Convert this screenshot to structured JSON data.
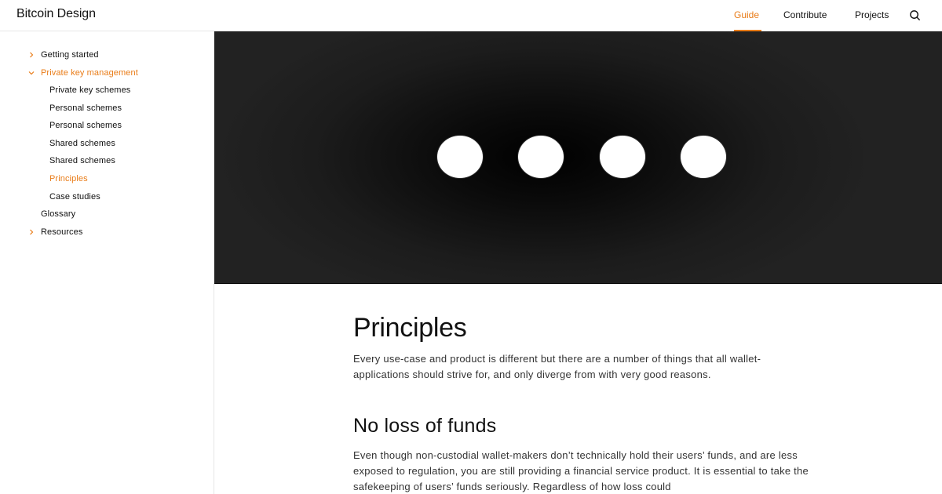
{
  "header": {
    "logo": "Bitcoin Design",
    "nav": [
      {
        "label": "Guide",
        "active": true
      },
      {
        "label": "Contribute",
        "active": false
      },
      {
        "label": "Projects",
        "active": false
      }
    ],
    "search_icon": "search-icon"
  },
  "colors": {
    "accent": "#e97c18",
    "text": "#111111",
    "hero_bg": "#111111"
  },
  "sidebar": {
    "items": [
      {
        "label": "Getting started",
        "icon": "chevron-right-icon"
      },
      {
        "label": "Private key management",
        "icon": "chevron-down-icon"
      },
      {
        "label": "Private key schemes"
      },
      {
        "label": "Personal schemes"
      },
      {
        "label": "Personal schemes"
      },
      {
        "label": "Shared schemes"
      },
      {
        "label": "Shared schemes"
      },
      {
        "label": "Principles"
      },
      {
        "label": "Case studies"
      },
      {
        "label": "Glossary"
      },
      {
        "label": "Resources",
        "icon": "chevron-right-icon"
      }
    ]
  },
  "article": {
    "title": "Principles",
    "intro": "Every use-case and product is different but there are a number of things that all wallet-applications should strive for, and only diverge from with very good reasons.",
    "section_title": "No loss of funds",
    "section_text": "Even though non-custodial wallet-makers don’t technically hold their users’ funds, and are less exposed to regulation, you are still providing a financial service product. It is essential to take the safekeeping of users’ funds seriously. Regardless of how loss could"
  }
}
